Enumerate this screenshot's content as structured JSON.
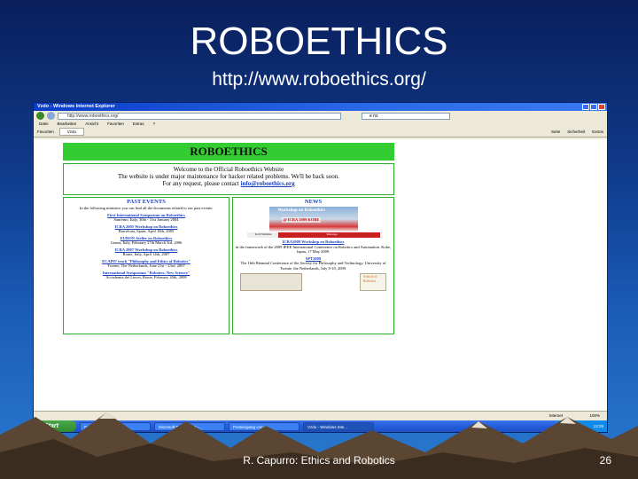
{
  "slide": {
    "title": "ROBOETHICS",
    "url": "http://www.roboethics.org/",
    "footer": "R. Capurro: Ethics and Robotics",
    "number": "26"
  },
  "browser": {
    "window_title": "Vzdo - Windows Internet Explorer",
    "address": "http://www.roboethics.org/",
    "search_text": "e ns",
    "menu": [
      "Datei",
      "Bearbeiten",
      "Ansicht",
      "Favoriten",
      "Extras",
      "?"
    ],
    "favorites_label": "Favoriten",
    "tab_label": "Vzdo",
    "commands": [
      "Seite",
      "Sicherheit",
      "Extras"
    ],
    "status_zone": "Internet",
    "zoom": "100%"
  },
  "page": {
    "banner": "ROBOETHICS",
    "welcome_line1": "Welcome to the Official Roboethics Website",
    "welcome_line2": "The website is under major maintenance for hacker related problems. We'll be back soon.",
    "welcome_line3_prefix": "For any request, please contact ",
    "welcome_email": "info@roboethics.org",
    "past_events_heading": "PAST EVENTS",
    "past_events_intro": "In the following minisites you can find all the documents related to our past events:",
    "events": [
      {
        "title": "First International Symposium on Roboethics",
        "detail": "Sanremo, Italy, 30th - 31st January 2004"
      },
      {
        "title": "ICRA 2005 Workshop on Roboethics",
        "detail": "Barcelona, Spain, April 18th, 2005"
      },
      {
        "title": "EURON Atelier on Roboethics",
        "detail": "Genoa, Italy, February 27th March 3rd, 2006"
      },
      {
        "title": "ICRA 2007 Workshop on Roboethics",
        "detail": "Rome, Italy, April 14th, 2007"
      },
      {
        "title": "ECAP07 track \"Philosophy and Ethics of Robotics\"",
        "detail": "Twente, The Netherlands, June 21st - 23rd, 2007"
      },
      {
        "title": "International Symposium \"Robotics: New Science\"",
        "detail": "Accademia dei Lincei, Rome, February 20th, 2008"
      }
    ],
    "news_heading": "NEWS",
    "news_image_label": "Workshop on Roboethics",
    "news_image_label2": "@ ICRA 2009 KOBE",
    "news_bar_left": "Tech Website",
    "news_bar_right": "Message",
    "news_items": [
      {
        "title": "ICRA2009 Workshop on Roboethics",
        "detail": "in the framework of the 2009 IEEE International Conference on Robotics and Automation. Kobe, Japan, 17 May 2009."
      },
      {
        "title": "SPT2009",
        "detail": "The 16th Biennial Conference of the Society for Philosophy and Technology. University of Twente, the Netherlands, July 8-10, 2009."
      }
    ],
    "school_logo": "School of Robotics"
  },
  "taskbar": {
    "start": "Start",
    "tasks": [
      "Posteingang von ca...",
      "Microsoft PowerPoint -...",
      "Posteingang von ca...",
      "Vzdo - Windows Inte..."
    ],
    "clock": "13:29"
  }
}
